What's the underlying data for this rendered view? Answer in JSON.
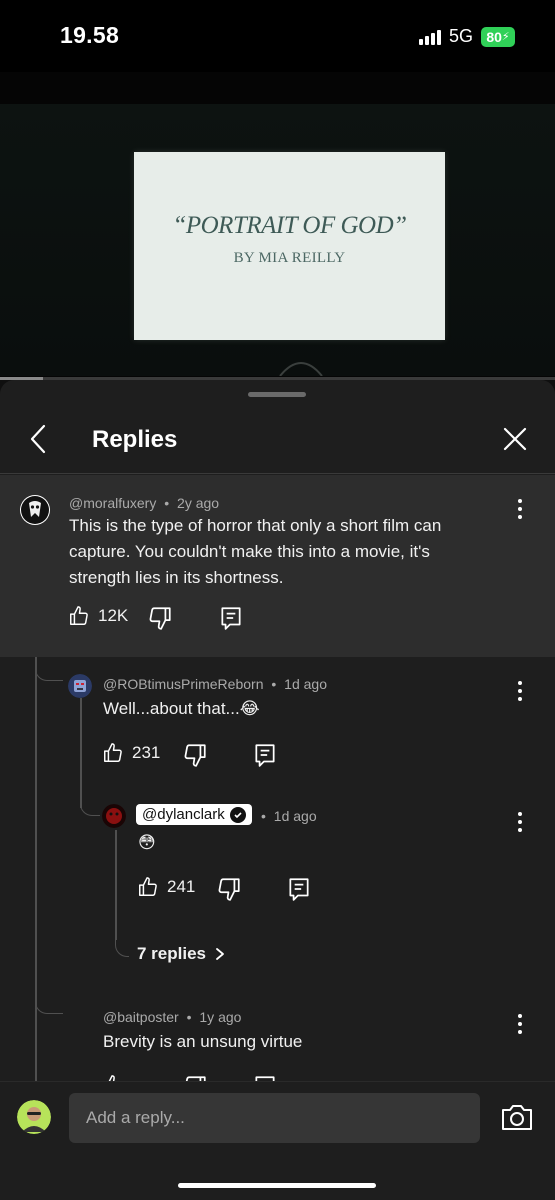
{
  "status_bar": {
    "time": "19.58",
    "network": "5G",
    "battery": "80"
  },
  "video": {
    "title": "“PORTRAIT OF GOD”",
    "subtitle": "BY MIA REILLY",
    "progress_fraction": 0.077
  },
  "sheet": {
    "title": "Replies"
  },
  "top_comment": {
    "author": "@moralfuxery",
    "age": "2y ago",
    "text": "This is the type of horror that only a short film can capture. You couldn't make this into a movie, it's strength lies in its shortness.",
    "likes": "12K"
  },
  "replies": [
    {
      "author": "@ROBtimusPrimeReborn",
      "age": "1d ago",
      "text": "Well...about that...😂",
      "likes": "231"
    },
    {
      "author": "@dylanclark",
      "age": "1d ago",
      "text": "😳",
      "likes": "241",
      "verified": true
    },
    {
      "author": "@baitposter",
      "age": "1y ago",
      "text": "Brevity is an unsung virtue",
      "likes": ""
    }
  ],
  "more_replies_label": "7 replies",
  "composer": {
    "placeholder": "Add a reply..."
  },
  "colors": {
    "battery": "#30d158",
    "sheet_bg": "#1e1e1e",
    "highlight_bg": "#2d2d2d"
  },
  "icons": [
    "back-chevron-icon",
    "close-icon",
    "kebab-menu-icon",
    "thumbs-up-icon",
    "thumbs-down-icon",
    "reply-comment-icon",
    "camera-icon"
  ]
}
